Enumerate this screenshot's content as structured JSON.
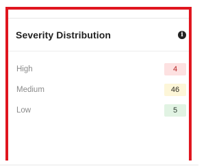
{
  "widget": {
    "title": "Severity Distribution",
    "info_icon": "info-icon",
    "items": [
      {
        "label": "High",
        "count": "4",
        "color": "#fde1e1"
      },
      {
        "label": "Medium",
        "count": "46",
        "color": "#fdf6d8"
      },
      {
        "label": "Low",
        "count": "5",
        "color": "#e1f3e3"
      }
    ]
  },
  "highlight_color": "#e0161f"
}
